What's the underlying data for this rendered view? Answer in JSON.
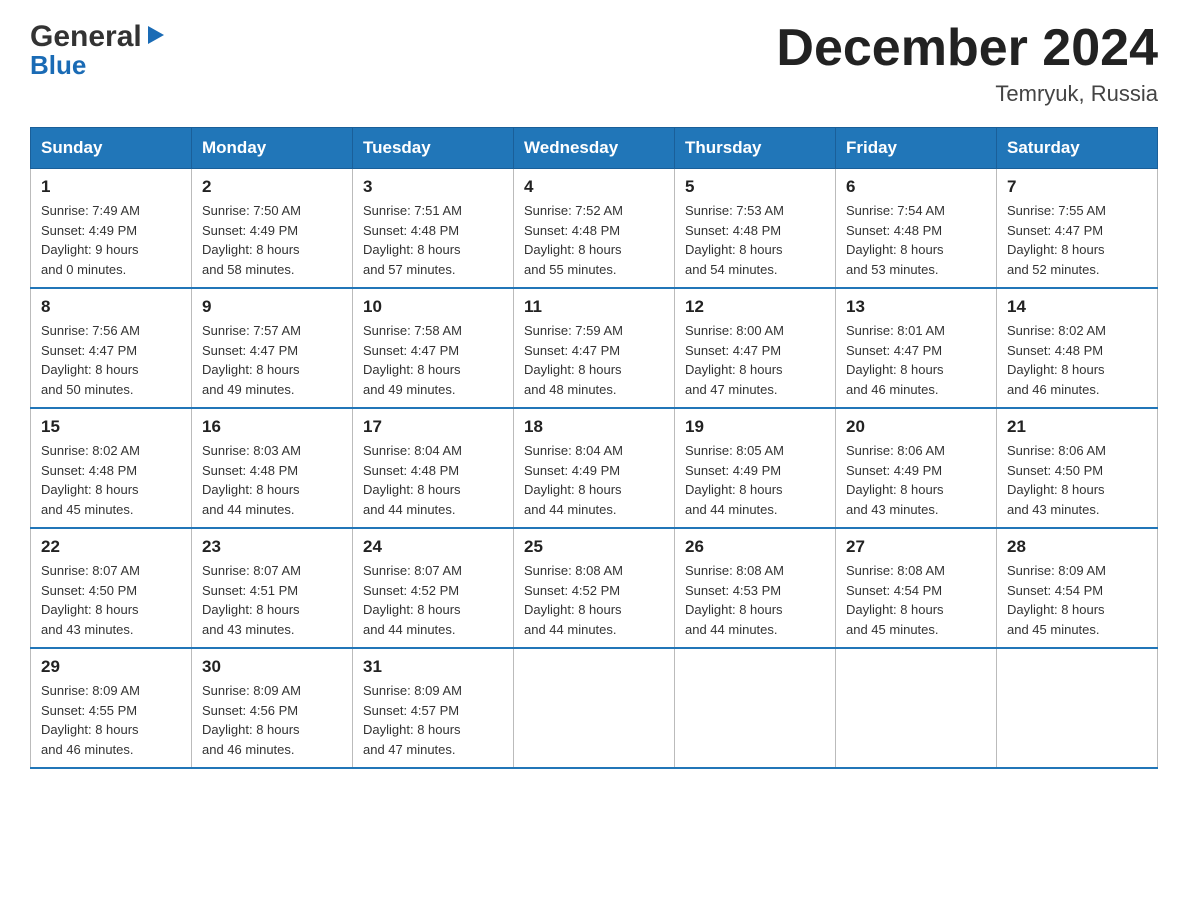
{
  "header": {
    "logo_general": "General",
    "logo_blue": "Blue",
    "title": "December 2024",
    "location": "Temryuk, Russia"
  },
  "calendar": {
    "days_of_week": [
      "Sunday",
      "Monday",
      "Tuesday",
      "Wednesday",
      "Thursday",
      "Friday",
      "Saturday"
    ],
    "weeks": [
      [
        {
          "day": "1",
          "sunrise": "7:49 AM",
          "sunset": "4:49 PM",
          "daylight": "9 hours and 0 minutes."
        },
        {
          "day": "2",
          "sunrise": "7:50 AM",
          "sunset": "4:49 PM",
          "daylight": "8 hours and 58 minutes."
        },
        {
          "day": "3",
          "sunrise": "7:51 AM",
          "sunset": "4:48 PM",
          "daylight": "8 hours and 57 minutes."
        },
        {
          "day": "4",
          "sunrise": "7:52 AM",
          "sunset": "4:48 PM",
          "daylight": "8 hours and 55 minutes."
        },
        {
          "day": "5",
          "sunrise": "7:53 AM",
          "sunset": "4:48 PM",
          "daylight": "8 hours and 54 minutes."
        },
        {
          "day": "6",
          "sunrise": "7:54 AM",
          "sunset": "4:48 PM",
          "daylight": "8 hours and 53 minutes."
        },
        {
          "day": "7",
          "sunrise": "7:55 AM",
          "sunset": "4:47 PM",
          "daylight": "8 hours and 52 minutes."
        }
      ],
      [
        {
          "day": "8",
          "sunrise": "7:56 AM",
          "sunset": "4:47 PM",
          "daylight": "8 hours and 50 minutes."
        },
        {
          "day": "9",
          "sunrise": "7:57 AM",
          "sunset": "4:47 PM",
          "daylight": "8 hours and 49 minutes."
        },
        {
          "day": "10",
          "sunrise": "7:58 AM",
          "sunset": "4:47 PM",
          "daylight": "8 hours and 49 minutes."
        },
        {
          "day": "11",
          "sunrise": "7:59 AM",
          "sunset": "4:47 PM",
          "daylight": "8 hours and 48 minutes."
        },
        {
          "day": "12",
          "sunrise": "8:00 AM",
          "sunset": "4:47 PM",
          "daylight": "8 hours and 47 minutes."
        },
        {
          "day": "13",
          "sunrise": "8:01 AM",
          "sunset": "4:47 PM",
          "daylight": "8 hours and 46 minutes."
        },
        {
          "day": "14",
          "sunrise": "8:02 AM",
          "sunset": "4:48 PM",
          "daylight": "8 hours and 46 minutes."
        }
      ],
      [
        {
          "day": "15",
          "sunrise": "8:02 AM",
          "sunset": "4:48 PM",
          "daylight": "8 hours and 45 minutes."
        },
        {
          "day": "16",
          "sunrise": "8:03 AM",
          "sunset": "4:48 PM",
          "daylight": "8 hours and 44 minutes."
        },
        {
          "day": "17",
          "sunrise": "8:04 AM",
          "sunset": "4:48 PM",
          "daylight": "8 hours and 44 minutes."
        },
        {
          "day": "18",
          "sunrise": "8:04 AM",
          "sunset": "4:49 PM",
          "daylight": "8 hours and 44 minutes."
        },
        {
          "day": "19",
          "sunrise": "8:05 AM",
          "sunset": "4:49 PM",
          "daylight": "8 hours and 44 minutes."
        },
        {
          "day": "20",
          "sunrise": "8:06 AM",
          "sunset": "4:49 PM",
          "daylight": "8 hours and 43 minutes."
        },
        {
          "day": "21",
          "sunrise": "8:06 AM",
          "sunset": "4:50 PM",
          "daylight": "8 hours and 43 minutes."
        }
      ],
      [
        {
          "day": "22",
          "sunrise": "8:07 AM",
          "sunset": "4:50 PM",
          "daylight": "8 hours and 43 minutes."
        },
        {
          "day": "23",
          "sunrise": "8:07 AM",
          "sunset": "4:51 PM",
          "daylight": "8 hours and 43 minutes."
        },
        {
          "day": "24",
          "sunrise": "8:07 AM",
          "sunset": "4:52 PM",
          "daylight": "8 hours and 44 minutes."
        },
        {
          "day": "25",
          "sunrise": "8:08 AM",
          "sunset": "4:52 PM",
          "daylight": "8 hours and 44 minutes."
        },
        {
          "day": "26",
          "sunrise": "8:08 AM",
          "sunset": "4:53 PM",
          "daylight": "8 hours and 44 minutes."
        },
        {
          "day": "27",
          "sunrise": "8:08 AM",
          "sunset": "4:54 PM",
          "daylight": "8 hours and 45 minutes."
        },
        {
          "day": "28",
          "sunrise": "8:09 AM",
          "sunset": "4:54 PM",
          "daylight": "8 hours and 45 minutes."
        }
      ],
      [
        {
          "day": "29",
          "sunrise": "8:09 AM",
          "sunset": "4:55 PM",
          "daylight": "8 hours and 46 minutes."
        },
        {
          "day": "30",
          "sunrise": "8:09 AM",
          "sunset": "4:56 PM",
          "daylight": "8 hours and 46 minutes."
        },
        {
          "day": "31",
          "sunrise": "8:09 AM",
          "sunset": "4:57 PM",
          "daylight": "8 hours and 47 minutes."
        },
        null,
        null,
        null,
        null
      ]
    ],
    "sunrise_label": "Sunrise:",
    "sunset_label": "Sunset:",
    "daylight_label": "Daylight:"
  }
}
